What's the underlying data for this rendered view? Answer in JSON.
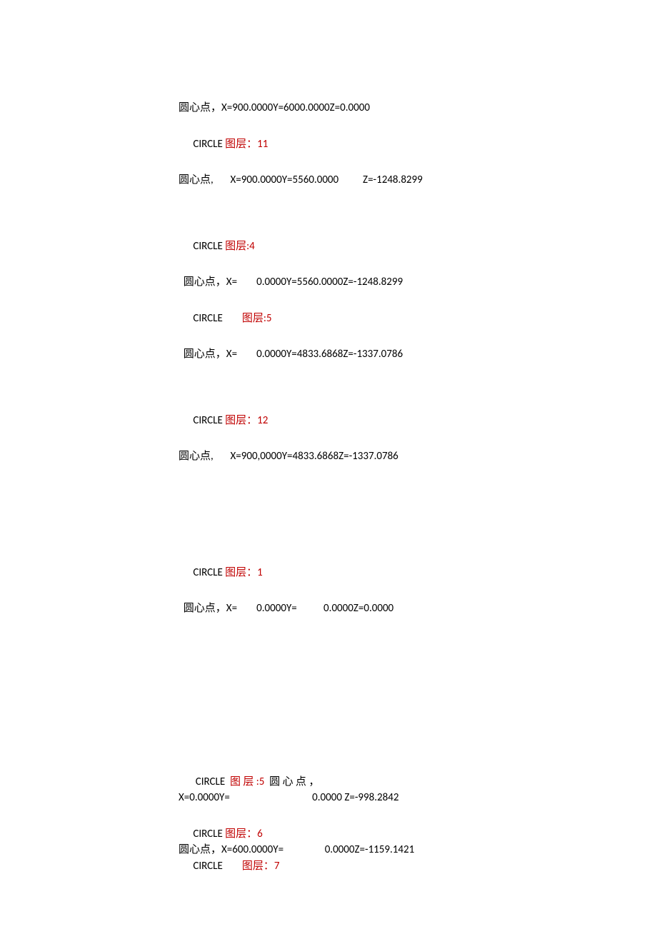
{
  "lines": [
    {
      "type": "text",
      "segments": [
        {
          "t": "圆心点，X=900.0000Y=6000.0000Z=0.0000"
        }
      ]
    },
    {
      "type": "gap",
      "size": "sm"
    },
    {
      "type": "text",
      "segments": [
        {
          "t": "      CIRCLE "
        },
        {
          "t": "图层：11",
          "red": true
        }
      ]
    },
    {
      "type": "gap",
      "size": "sm"
    },
    {
      "type": "text",
      "segments": [
        {
          "t": "圆心点,       X=900.0000Y=5560.0000          Z=-1248.8299"
        }
      ]
    },
    {
      "type": "gap",
      "size": "md"
    },
    {
      "type": "text",
      "segments": [
        {
          "t": "      CIRCLE "
        },
        {
          "t": "图层:4",
          "red": true
        }
      ]
    },
    {
      "type": "gap",
      "size": "sm"
    },
    {
      "type": "text",
      "segments": [
        {
          "t": "  圆心点，X=        0.0000Y=5560.0000Z=-1248.8299"
        }
      ]
    },
    {
      "type": "gap",
      "size": "sm"
    },
    {
      "type": "text",
      "segments": [
        {
          "t": "      CIRCLE        "
        },
        {
          "t": "图层:5",
          "red": true
        }
      ]
    },
    {
      "type": "gap",
      "size": "sm"
    },
    {
      "type": "text",
      "segments": [
        {
          "t": "  圆心点，X=        0.0000Y=4833.6868Z=-1337.0786"
        }
      ]
    },
    {
      "type": "gap",
      "size": "md"
    },
    {
      "type": "text",
      "segments": [
        {
          "t": "      CIRCLE "
        },
        {
          "t": "图层：12",
          "red": true
        }
      ]
    },
    {
      "type": "gap",
      "size": "sm"
    },
    {
      "type": "text",
      "segments": [
        {
          "t": "圆心点,       X=900,0000Y=4833.6868Z=-1337.0786"
        }
      ]
    },
    {
      "type": "gap",
      "size": "lg"
    },
    {
      "type": "text",
      "segments": [
        {
          "t": "      CIRCLE "
        },
        {
          "t": "图层：1",
          "red": true
        }
      ]
    },
    {
      "type": "gap",
      "size": "sm"
    },
    {
      "type": "text",
      "segments": [
        {
          "t": "  圆心点，X=        0.0000Y=           0.0000Z=0.0000"
        }
      ]
    },
    {
      "type": "gap",
      "size": "xl"
    },
    {
      "type": "text",
      "segments": [
        {
          "t": "       CIRCLE  "
        },
        {
          "t": "图 层 :5",
          "red": true
        },
        {
          "t": "  圆 心 点 ，"
        }
      ]
    },
    {
      "type": "text",
      "segments": [
        {
          "t": "X=0.0000Y=                                  0.0000 Z=-998.2842"
        }
      ]
    },
    {
      "type": "gap",
      "size": "sm"
    },
    {
      "type": "text",
      "segments": [
        {
          "t": "      CIRCLE "
        },
        {
          "t": "图层：6",
          "red": true
        }
      ]
    },
    {
      "type": "text",
      "segments": [
        {
          "t": "圆心点，X=600.0000Y=                 0.0000Z=-1159.1421"
        }
      ]
    },
    {
      "type": "text",
      "segments": [
        {
          "t": "      CIRCLE        "
        },
        {
          "t": "图层：7",
          "red": true
        }
      ]
    }
  ]
}
